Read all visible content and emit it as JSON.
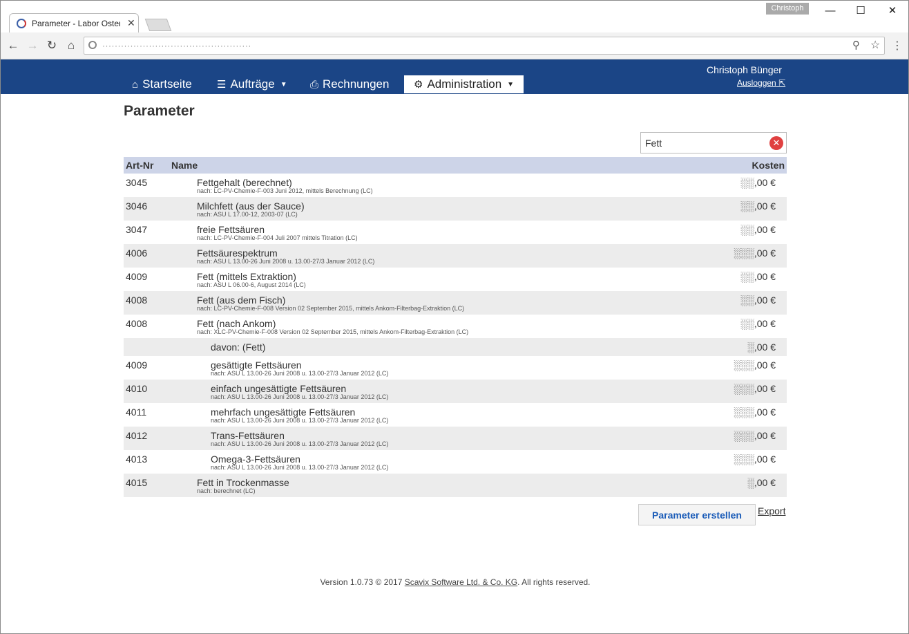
{
  "browser": {
    "tab_title": "Parameter - Labor Osterl",
    "tab_close": "✕",
    "profile": "Christoph",
    "url": "················································",
    "window_minimize": "—",
    "window_maximize": "☐",
    "window_close": "✕",
    "icons": {
      "back": "arrow-left-icon",
      "forward": "arrow-right-icon",
      "reload": "reload-icon",
      "home": "home-icon",
      "zoom": "zoom-icon",
      "bookmark": "star-icon",
      "menu": "menu-dots-icon"
    }
  },
  "header": {
    "colors": {
      "bar": "#1b4586"
    },
    "nav": [
      {
        "label": "Startseite",
        "icon": "home-icon"
      },
      {
        "label": "Aufträge",
        "icon": "list-icon"
      },
      {
        "label": "Rechnungen",
        "icon": "printer-icon"
      },
      {
        "label": "Administration",
        "icon": "gear-icon"
      }
    ],
    "user_name": "Christoph Bünger",
    "logout_label": "Ausloggen"
  },
  "main": {
    "title": "Parameter",
    "search_value": "Fett",
    "columns": {
      "art": "Art-Nr",
      "name": "Name",
      "cost": "Kosten"
    },
    "rows": [
      {
        "art": "3045",
        "name": "Fettgehalt (berechnet)",
        "sub": "nach: LC-PV-Chemie-F-003 Juni 2012, mittels Berechnung (LC)",
        "cost": "░░,00 €"
      },
      {
        "art": "3046",
        "name": "Milchfett (aus der Sauce)",
        "sub": "nach: ASU L 17.00-12, 2003-07 (LC)",
        "cost": "░░,00 €"
      },
      {
        "art": "3047",
        "name": "freie Fettsäuren",
        "sub": "nach: LC-PV-Chemie-F-004 Juli 2007 mittels Titration (LC)",
        "cost": "░░,00 €"
      },
      {
        "art": "4006",
        "name": "Fettsäurespektrum",
        "sub": "nach: ASU L 13.00-26 Juni 2008 u. 13.00-27/3 Januar 2012 (LC)",
        "cost": "░░░,00 €"
      },
      {
        "art": "4009",
        "name": "Fett (mittels Extraktion)",
        "sub": "nach: ASU L 06.00-6, August 2014 (LC)",
        "cost": "░░,00 €"
      },
      {
        "art": "4008",
        "name": "Fett (aus dem Fisch)",
        "sub": "nach: LC-PV-Chemie-F-008 Version 02 September 2015, mittels Ankom-Filterbag-Extraktion (LC)",
        "cost": "░░,00 €"
      },
      {
        "art": "4008",
        "name": "Fett (nach Ankom)",
        "sub": "nach: XLC-PV-Chemie-F-008 Version 02 September 2015, mittels Ankom-Filterbag-Extraktion (LC)",
        "cost": "░░,00 €"
      },
      {
        "art": "",
        "name": "davon: (Fett)",
        "sub": "",
        "cost": "░,00 €"
      },
      {
        "art": "4009",
        "name": "gesättigte Fettsäuren",
        "sub": "nach: ASU L 13.00-26 Juni 2008 u. 13.00-27/3 Januar 2012 (LC)",
        "cost": "░░░,00 €"
      },
      {
        "art": "4010",
        "name": "einfach ungesättigte Fettsäuren",
        "sub": "nach: ASU L 13.00-26 Juni 2008 u. 13.00-27/3 Januar 2012 (LC)",
        "cost": "░░░,00 €"
      },
      {
        "art": "4011",
        "name": "mehrfach ungesättigte Fettsäuren",
        "sub": "nach: ASU L 13.00-26 Juni 2008 u. 13.00-27/3 Januar 2012 (LC)",
        "cost": "░░░,00 €"
      },
      {
        "art": "4012",
        "name": "Trans-Fettsäuren",
        "sub": "nach: ASU L 13.00-26 Juni 2008 u. 13.00-27/3 Januar 2012 (LC)",
        "cost": "░░░,00 €"
      },
      {
        "art": "4013",
        "name": "Omega-3-Fettsäuren",
        "sub": "nach: ASU L 13.00-26 Juni 2008 u. 13.00-27/3 Januar 2012 (LC)",
        "cost": "░░░,00 €"
      },
      {
        "art": "4015",
        "name": "Fett in Trockenmasse",
        "sub": "nach: berechnet (LC)",
        "cost": "░,00 €"
      }
    ],
    "create_button": "Parameter erstellen",
    "export_label": "Export"
  },
  "footer": {
    "version": "Version 1.0.73 © 2017 ",
    "company": "Scavix Software Ltd. & Co. KG",
    "rights": ". All rights reserved."
  }
}
